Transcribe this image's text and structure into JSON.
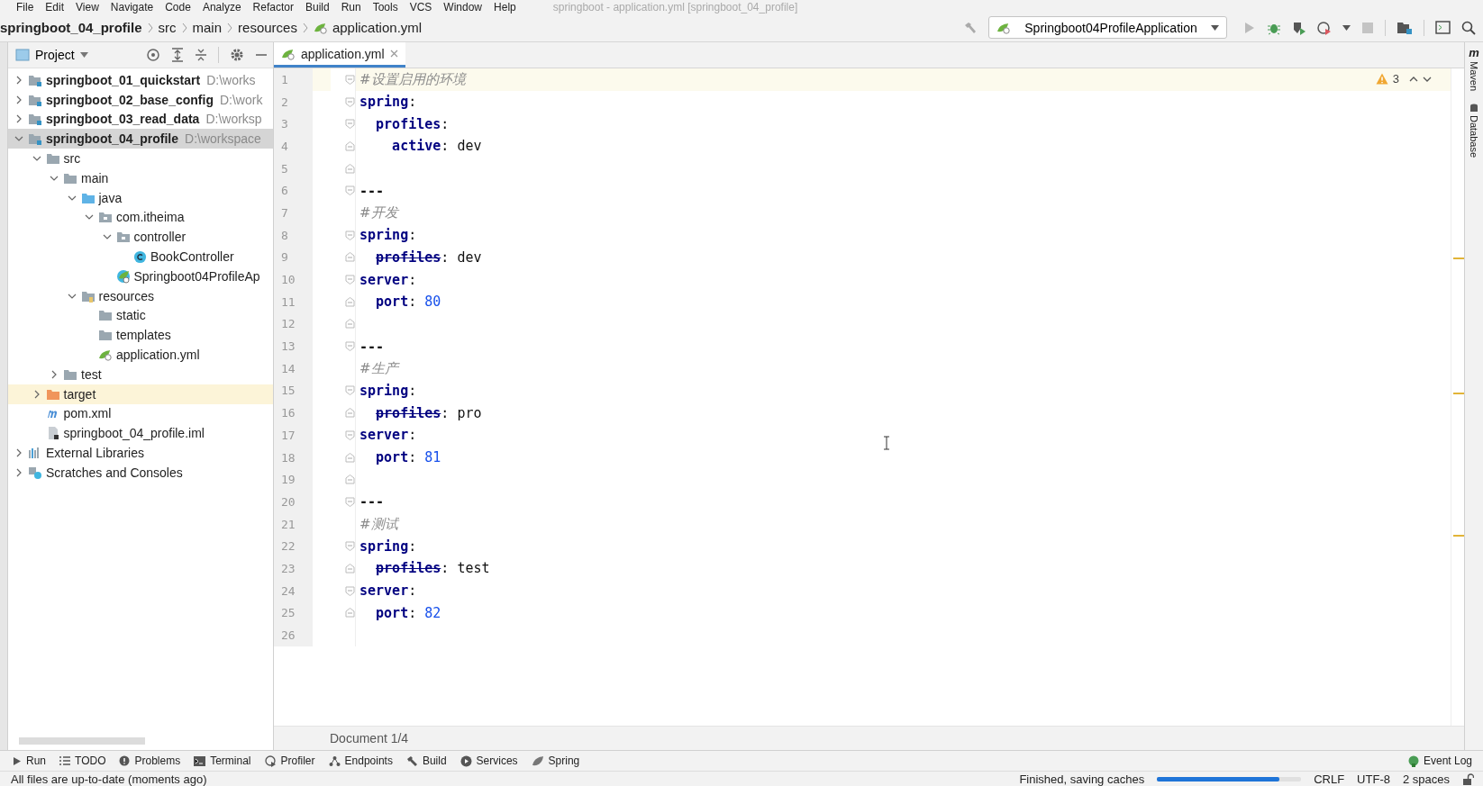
{
  "menu": [
    "File",
    "Edit",
    "View",
    "Navigate",
    "Code",
    "Analyze",
    "Refactor",
    "Build",
    "Run",
    "Tools",
    "VCS",
    "Window",
    "Help"
  ],
  "window": {
    "title": "springboot - application.yml [springboot_04_profile]"
  },
  "breadcrumbs": [
    {
      "label": "springboot_04_profile",
      "kind": "project"
    },
    {
      "label": "src",
      "kind": "folder"
    },
    {
      "label": "main",
      "kind": "folder"
    },
    {
      "label": "resources",
      "kind": "folder"
    },
    {
      "label": "application.yml",
      "kind": "yaml"
    }
  ],
  "run_config": {
    "label": "Springboot04ProfileApplication"
  },
  "project_panel": {
    "title": "Project",
    "tree": [
      {
        "label": "springboot_01_quickstart",
        "hint": "D:\\works",
        "kind": "module",
        "expanded": false,
        "selected": false
      },
      {
        "label": "springboot_02_base_config",
        "hint": "D:\\work",
        "kind": "module",
        "expanded": false,
        "selected": false
      },
      {
        "label": "springboot_03_read_data",
        "hint": "D:\\worksp",
        "kind": "module",
        "expanded": false,
        "selected": false
      },
      {
        "label": "springboot_04_profile",
        "hint": "D:\\workspace",
        "kind": "module",
        "expanded": true,
        "selected": true,
        "children": [
          {
            "label": "src",
            "kind": "folder",
            "expanded": true,
            "selected": false,
            "children": [
              {
                "label": "main",
                "kind": "folder",
                "expanded": true,
                "selected": false,
                "children": [
                  {
                    "label": "java",
                    "kind": "source",
                    "expanded": true,
                    "selected": false,
                    "children": [
                      {
                        "label": "com.itheima",
                        "kind": "package",
                        "expanded": true,
                        "selected": false,
                        "children": [
                          {
                            "label": "controller",
                            "kind": "package",
                            "expanded": true,
                            "selected": false,
                            "children": [
                              {
                                "label": "BookController",
                                "kind": "class",
                                "selected": false
                              }
                            ]
                          },
                          {
                            "label": "Springboot04ProfileAp",
                            "kind": "spring-class",
                            "selected": false
                          }
                        ]
                      }
                    ]
                  },
                  {
                    "label": "resources",
                    "kind": "resources",
                    "expanded": true,
                    "selected": false,
                    "children": [
                      {
                        "label": "static",
                        "kind": "folder",
                        "selected": false
                      },
                      {
                        "label": "templates",
                        "kind": "folder",
                        "selected": false
                      },
                      {
                        "label": "application.yml",
                        "kind": "yaml",
                        "selected": false
                      }
                    ]
                  }
                ]
              },
              {
                "label": "test",
                "kind": "folder",
                "expanded": false,
                "selected": false
              }
            ]
          },
          {
            "label": "target",
            "kind": "excluded",
            "expanded": false,
            "selected": false,
            "excluded": true
          },
          {
            "label": "pom.xml",
            "kind": "maven",
            "selected": false
          },
          {
            "label": "springboot_04_profile.iml",
            "kind": "iml",
            "selected": false
          }
        ]
      },
      {
        "label": "External Libraries",
        "kind": "libraries",
        "expanded": false,
        "selected": false
      },
      {
        "label": "Scratches and Consoles",
        "kind": "scratches",
        "expanded": false,
        "selected": false
      }
    ]
  },
  "editor": {
    "tabs": [
      {
        "label": "application.yml",
        "selected": true
      }
    ],
    "warnings": "3",
    "footer": "Document 1/4",
    "lines": [
      {
        "number": "1",
        "current": true,
        "fold_open": true,
        "tokens": [
          {
            "kind": "comment",
            "text": "#设置启用的环境"
          }
        ]
      },
      {
        "number": "2",
        "current": false,
        "fold_open": true,
        "tokens": [
          {
            "kind": "key",
            "text": "spring"
          },
          {
            "kind": "punct",
            "text": ":"
          }
        ]
      },
      {
        "number": "3",
        "current": false,
        "fold_open": true,
        "tokens": [
          {
            "kind": "key",
            "text": "  profiles"
          },
          {
            "kind": "punct",
            "text": ":"
          }
        ]
      },
      {
        "number": "4",
        "current": false,
        "fold_open": false,
        "tokens": [
          {
            "kind": "key",
            "text": "    active"
          },
          {
            "kind": "punct",
            "text": ": "
          },
          {
            "kind": "value",
            "text": "dev"
          }
        ]
      },
      {
        "number": "5",
        "current": false,
        "fold_open": false
      },
      {
        "number": "6",
        "current": false,
        "fold_open": true,
        "tokens": [
          {
            "kind": "separator",
            "text": "---"
          }
        ]
      },
      {
        "number": "7",
        "current": false,
        "tokens": [
          {
            "kind": "comment",
            "text": "#开发"
          }
        ]
      },
      {
        "number": "8",
        "current": false,
        "fold_open": true,
        "tokens": [
          {
            "kind": "key",
            "text": "spring"
          },
          {
            "kind": "punct",
            "text": ":"
          }
        ]
      },
      {
        "number": "9",
        "current": false,
        "fold_open": false,
        "tokens": [
          {
            "kind": "deprecated",
            "text": "  profiles"
          },
          {
            "kind": "punct",
            "text": ": "
          },
          {
            "kind": "value",
            "text": "dev"
          }
        ]
      },
      {
        "number": "10",
        "current": false,
        "fold_open": true,
        "tokens": [
          {
            "kind": "key",
            "text": "server"
          },
          {
            "kind": "punct",
            "text": ":"
          }
        ]
      },
      {
        "number": "11",
        "current": false,
        "fold_open": false,
        "tokens": [
          {
            "kind": "key",
            "text": "  port"
          },
          {
            "kind": "punct",
            "text": ": "
          },
          {
            "kind": "number",
            "text": "80"
          }
        ]
      },
      {
        "number": "12",
        "current": false,
        "fold_open": false
      },
      {
        "number": "13",
        "current": false,
        "fold_open": true,
        "tokens": [
          {
            "kind": "separator",
            "text": "---"
          }
        ]
      },
      {
        "number": "14",
        "current": false,
        "tokens": [
          {
            "kind": "comment",
            "text": "#生产"
          }
        ]
      },
      {
        "number": "15",
        "current": false,
        "fold_open": true,
        "tokens": [
          {
            "kind": "key",
            "text": "spring"
          },
          {
            "kind": "punct",
            "text": ":"
          }
        ]
      },
      {
        "number": "16",
        "current": false,
        "fold_open": false,
        "tokens": [
          {
            "kind": "deprecated",
            "text": "  profiles"
          },
          {
            "kind": "punct",
            "text": ": "
          },
          {
            "kind": "value",
            "text": "pro"
          }
        ]
      },
      {
        "number": "17",
        "current": false,
        "fold_open": true,
        "tokens": [
          {
            "kind": "key",
            "text": "server"
          },
          {
            "kind": "punct",
            "text": ":"
          }
        ]
      },
      {
        "number": "18",
        "current": false,
        "fold_open": false,
        "tokens": [
          {
            "kind": "key",
            "text": "  port"
          },
          {
            "kind": "punct",
            "text": ": "
          },
          {
            "kind": "number",
            "text": "81"
          }
        ]
      },
      {
        "number": "19",
        "current": false,
        "fold_open": false
      },
      {
        "number": "20",
        "current": false,
        "fold_open": true,
        "tokens": [
          {
            "kind": "separator",
            "text": "---"
          }
        ]
      },
      {
        "number": "21",
        "current": false,
        "tokens": [
          {
            "kind": "comment",
            "text": "#测试"
          }
        ]
      },
      {
        "number": "22",
        "current": false,
        "fold_open": true,
        "tokens": [
          {
            "kind": "key",
            "text": "spring"
          },
          {
            "kind": "punct",
            "text": ":"
          }
        ]
      },
      {
        "number": "23",
        "current": false,
        "fold_open": false,
        "tokens": [
          {
            "kind": "deprecated",
            "text": "  profiles"
          },
          {
            "kind": "punct",
            "text": ": "
          },
          {
            "kind": "value",
            "text": "test"
          }
        ]
      },
      {
        "number": "24",
        "current": false,
        "fold_open": true,
        "tokens": [
          {
            "kind": "key",
            "text": "server"
          },
          {
            "kind": "punct",
            "text": ":"
          }
        ]
      },
      {
        "number": "25",
        "current": false,
        "fold_open": false,
        "tokens": [
          {
            "kind": "key",
            "text": "  port"
          },
          {
            "kind": "punct",
            "text": ": "
          },
          {
            "kind": "number",
            "text": "82"
          }
        ]
      },
      {
        "number": "26",
        "current": false
      }
    ]
  },
  "side_tools": [
    {
      "label": "Maven",
      "glyph": "m",
      "kind": "maven"
    },
    {
      "label": "Database",
      "kind": "database"
    }
  ],
  "tool_windows": [
    {
      "label": "Run",
      "kind": "run"
    },
    {
      "label": "TODO",
      "kind": "list"
    },
    {
      "label": "Problems",
      "kind": "problems"
    },
    {
      "label": "Terminal",
      "kind": "terminal"
    },
    {
      "label": "Profiler",
      "kind": "profiler"
    },
    {
      "label": "Endpoints",
      "kind": "endpoints"
    },
    {
      "label": "Build",
      "kind": "build"
    },
    {
      "label": "Services",
      "kind": "services"
    },
    {
      "label": "Spring",
      "kind": "spring"
    }
  ],
  "event_log": "Event Log",
  "status_bar": {
    "message": "All files are up-to-date (moments ago)",
    "task": "Finished, saving caches",
    "progress": {
      "level": 0.85
    },
    "line_separator": "CRLF",
    "encoding": "UTF-8",
    "indent": "2 spaces",
    "locked": false
  }
}
